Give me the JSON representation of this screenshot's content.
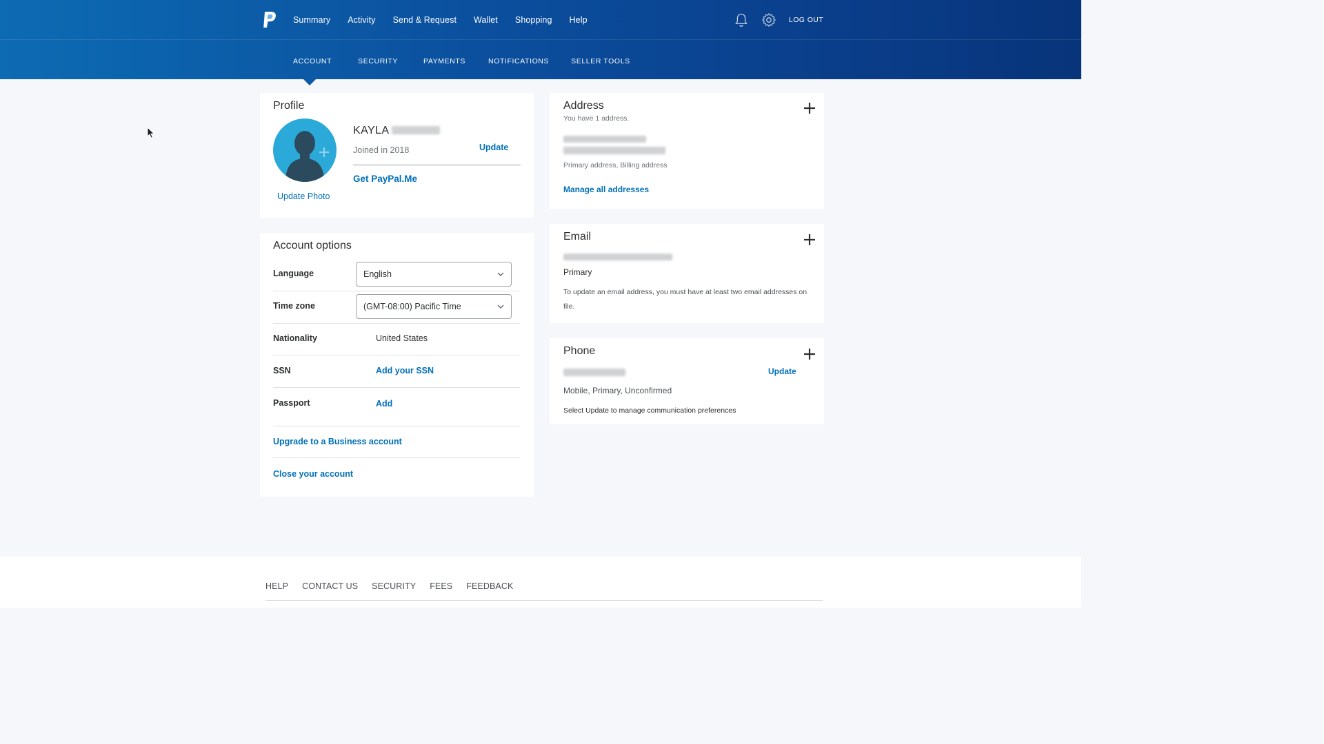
{
  "header": {
    "logo_icon": "paypal-logo",
    "nav": [
      "Summary",
      "Activity",
      "Send & Request",
      "Wallet",
      "Shopping",
      "Help"
    ],
    "logout": "LOG OUT",
    "icons": [
      "bell-icon",
      "gear-icon"
    ]
  },
  "subnav": {
    "items": [
      "ACCOUNT",
      "SECURITY",
      "PAYMENTS",
      "NOTIFICATIONS",
      "SELLER TOOLS"
    ],
    "active": "ACCOUNT"
  },
  "profile": {
    "title": "Profile",
    "name": "KAYLA",
    "joined": "Joined in 2018",
    "update": "Update",
    "paypalme": "Get PayPal.Me",
    "update_photo": "Update Photo"
  },
  "options": {
    "title": "Account options",
    "language_label": "Language",
    "language_value": "English",
    "timezone_label": "Time zone",
    "timezone_value": "(GMT-08:00) Pacific Time",
    "nationality_label": "Nationality",
    "nationality_value": "United States",
    "ssn_label": "SSN",
    "ssn_link": "Add your SSN",
    "passport_label": "Passport",
    "passport_link": "Add",
    "upgrade": "Upgrade to a Business account",
    "close": "Close your account"
  },
  "address": {
    "title": "Address",
    "subtitle": "You have 1 address.",
    "type": "Primary address, Billing address",
    "manage": "Manage all addresses"
  },
  "email": {
    "title": "Email",
    "primary": "Primary",
    "note": "To update an email address, you must have at least two email addresses on file."
  },
  "phone": {
    "title": "Phone",
    "update": "Update",
    "type": "Mobile, Primary, Unconfirmed",
    "pref": "Select Update to manage communication preferences"
  },
  "footer": {
    "links": [
      "HELP",
      "CONTACT US",
      "SECURITY",
      "FEES",
      "FEEDBACK"
    ]
  },
  "colors": {
    "brand_blue": "#0070ba",
    "header_start": "#0d6bb3",
    "header_end": "#08347a",
    "avatar": "#2ba9d8"
  }
}
